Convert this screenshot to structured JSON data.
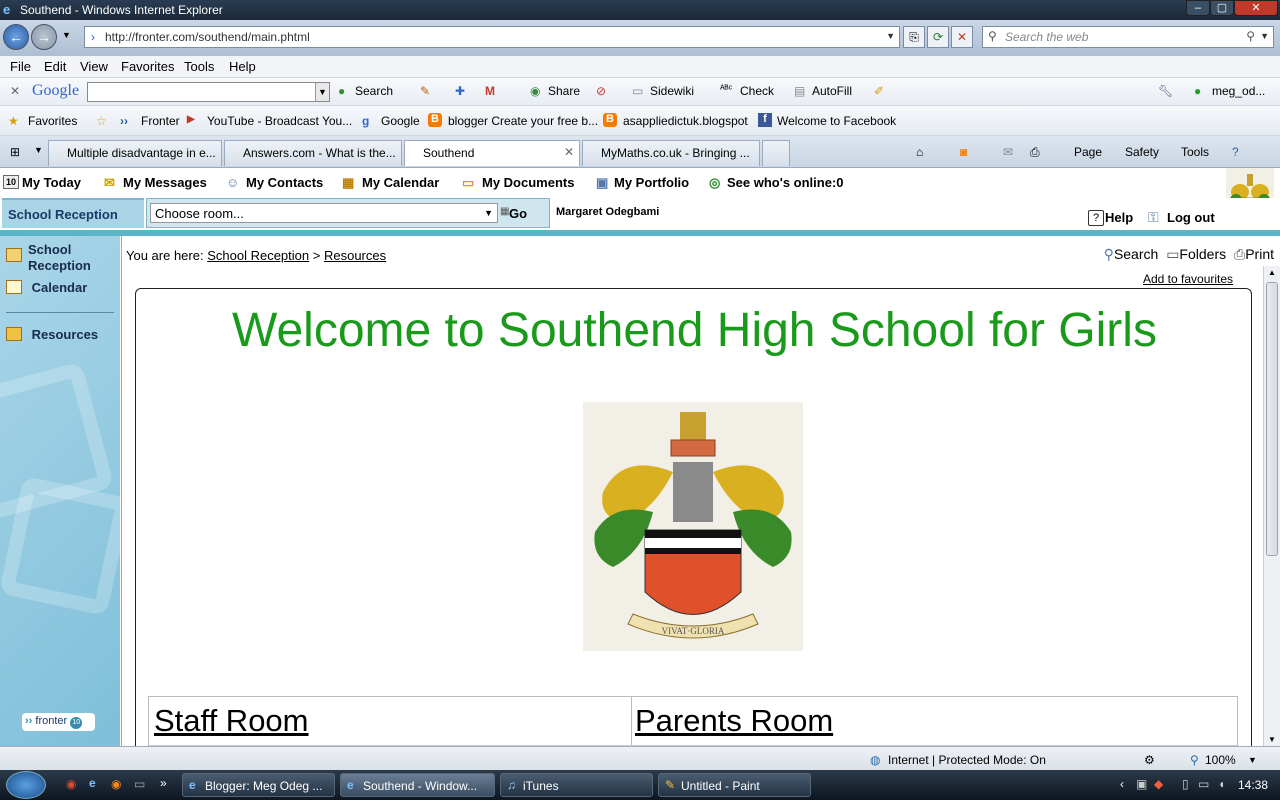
{
  "window": {
    "title": "Southend - Windows Internet Explorer"
  },
  "browser": {
    "address": "http://fronter.com/southend/main.phtml",
    "search_placeholder": "Search the web",
    "menu": [
      "File",
      "Edit",
      "View",
      "Favorites",
      "Tools",
      "Help"
    ],
    "google_bar": {
      "logo": "Google",
      "items": [
        "Search",
        "Share",
        "Sidewiki",
        "Check",
        "AutoFill"
      ],
      "account": "meg_od..."
    },
    "favorites": {
      "label": "Favorites",
      "links": [
        "Fronter",
        "YouTube - Broadcast You...",
        "Google",
        "blogger Create your free b...",
        "asappliedictuk.blogspot",
        "Welcome to Facebook"
      ]
    },
    "tabs": [
      {
        "label": "Multiple disadvantage in e...",
        "active": false
      },
      {
        "label": "Answers.com - What is the...",
        "active": false
      },
      {
        "label": "Southend",
        "active": true
      },
      {
        "label": "MyMaths.co.uk - Bringing ...",
        "active": false
      }
    ],
    "tab_tools": [
      "Page",
      "Safety",
      "Tools"
    ]
  },
  "fronter": {
    "nav": [
      {
        "label": "My Today",
        "icon": "calendar-day-icon",
        "icon_text": "10"
      },
      {
        "label": "My Messages",
        "icon": "envelope-icon"
      },
      {
        "label": "My Contacts",
        "icon": "contacts-icon"
      },
      {
        "label": "My Calendar",
        "icon": "calendar-icon"
      },
      {
        "label": "My Documents",
        "icon": "folder-icon"
      },
      {
        "label": "My Portfolio",
        "icon": "portfolio-icon"
      },
      {
        "label": "See who's online:0",
        "icon": "globe-icon"
      }
    ],
    "room": "School Reception",
    "room_select": "Choose room...",
    "go": "Go",
    "user": "Margaret Odegbami",
    "help": "Help",
    "logout": "Log out",
    "sidebar": [
      {
        "label": "School Reception",
        "icon": "reception-icon"
      },
      {
        "label": "Calendar",
        "icon": "calendar-icon"
      },
      {
        "label": "Resources",
        "icon": "folder-icon"
      }
    ],
    "logo": "fronter",
    "logo_badge": "10"
  },
  "content": {
    "breadcrumb_prefix": "You are here:",
    "breadcrumb": [
      "School Reception",
      "Resources"
    ],
    "breadcrumb_sep": ">",
    "tools": [
      "Search",
      "Folders",
      "Print"
    ],
    "add_fav": "Add to favourites",
    "welcome": "Welcome to Southend High School for Girls",
    "crest_motto": "VIVAT·GLORIA",
    "rooms": [
      "Staff Room",
      "Parents Room"
    ],
    "colors": {
      "welcome": "#1a9a1a",
      "teal": "#5bb5c8"
    }
  },
  "status": {
    "zone": "Internet | Protected Mode: On",
    "zoom": "100%"
  },
  "taskbar": {
    "items": [
      {
        "label": "Blogger: Meg Odeg ...",
        "active": false
      },
      {
        "label": "Southend - Window...",
        "active": true
      },
      {
        "label": "iTunes",
        "active": false
      },
      {
        "label": "Untitled - Paint",
        "active": false
      }
    ],
    "time": "14:38"
  }
}
